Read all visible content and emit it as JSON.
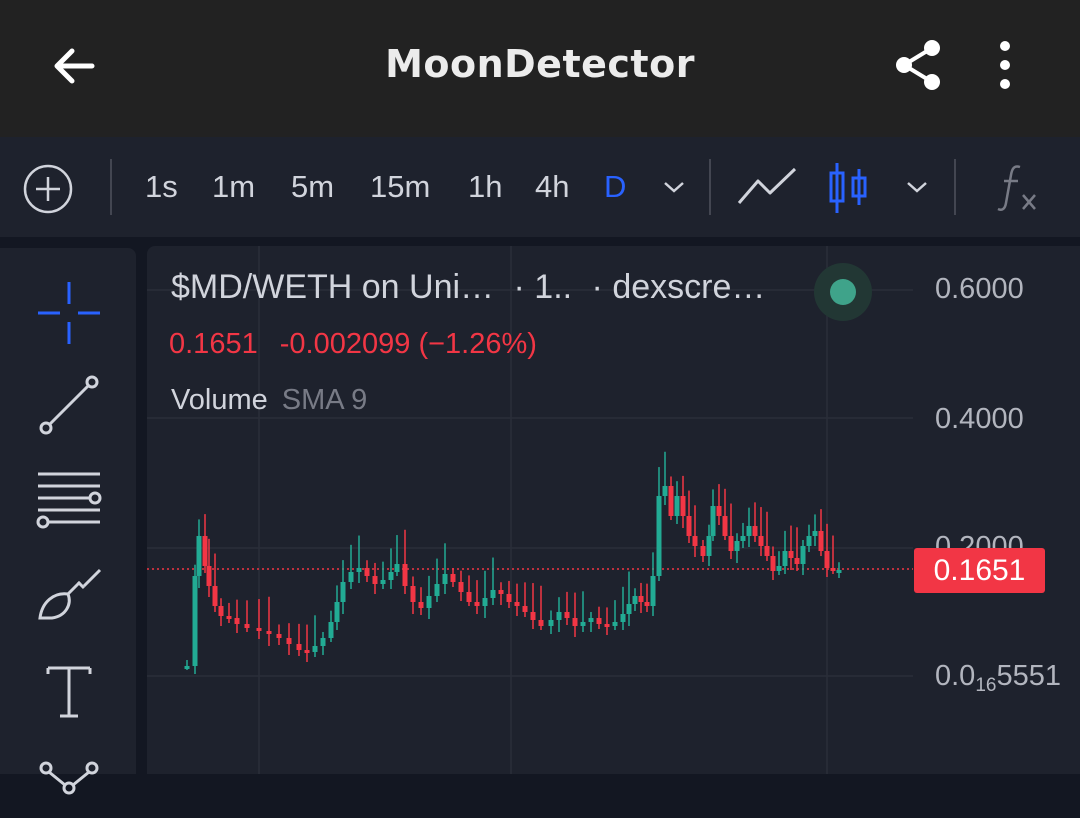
{
  "app_bar": {
    "title": "MoonDetector",
    "back_icon": "arrow-left-icon",
    "share_icon": "share-icon",
    "more_icon": "more-vertical-icon"
  },
  "toolbar": {
    "timeframes": [
      "1s",
      "1m",
      "5m",
      "15m",
      "1h",
      "4h",
      "D"
    ],
    "active_timeframe": "D",
    "active_color": "#2962ff",
    "icons": [
      "plus-circle-icon",
      "chevron-down-icon",
      "line-chart-icon",
      "candlestick-icon",
      "chevron-down-icon",
      "fx-icon"
    ]
  },
  "drawing_tools": [
    "crosshair-icon",
    "trend-line-icon",
    "horizontal-lines-icon",
    "brush-icon",
    "text-icon",
    "pattern-icon"
  ],
  "legend": {
    "symbol": "$MD/WETH on Uni…",
    "interval": "· 1..",
    "source": "· dexscre…",
    "price": "0.1651",
    "change": "-0.002099",
    "change_pct": "(−1.26%)",
    "volume_label": "Volume",
    "sma_label": "SMA 9"
  },
  "price_axis": {
    "labels": [
      "0.6000",
      "0.4000",
      "0.2000"
    ],
    "bottom_label_main": "0.0",
    "bottom_label_sub": "16",
    "bottom_label_tail": "5551",
    "current_price": "0.1651",
    "up_color": "#22ab94",
    "down_color": "#f23645"
  }
}
